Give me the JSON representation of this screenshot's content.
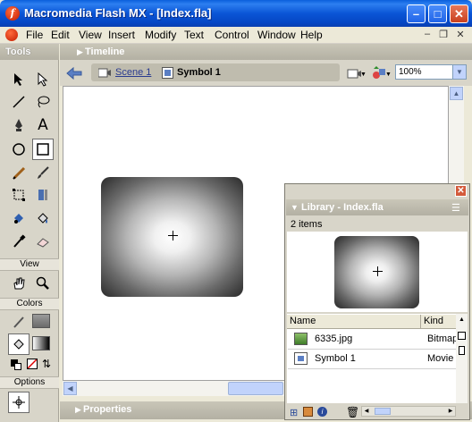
{
  "window": {
    "title": "Macromedia Flash MX - [Index.fla]",
    "minimize": "–",
    "maximize": "□",
    "close": "✕"
  },
  "menu": {
    "items": [
      "File",
      "Edit",
      "View",
      "Insert",
      "Modify",
      "Text",
      "Control",
      "Window",
      "Help"
    ]
  },
  "tools_panel": {
    "title": "Tools",
    "view_label": "View",
    "colors_label": "Colors",
    "options_label": "Options"
  },
  "timeline": {
    "title": "Timeline",
    "scene": "Scene 1",
    "symbol": "Symbol 1",
    "zoom": "100%"
  },
  "properties": {
    "title": "Properties"
  },
  "library": {
    "title": "Library - Index.fla",
    "count": "2 items",
    "columns": [
      "Name",
      "Kind"
    ],
    "items": [
      {
        "name": "6335.jpg",
        "kind": "Bitmap",
        "icon": "bitmap-icon"
      },
      {
        "name": "Symbol 1",
        "kind": "Movie",
        "icon": "movieclip-icon"
      }
    ],
    "close": "✕"
  }
}
